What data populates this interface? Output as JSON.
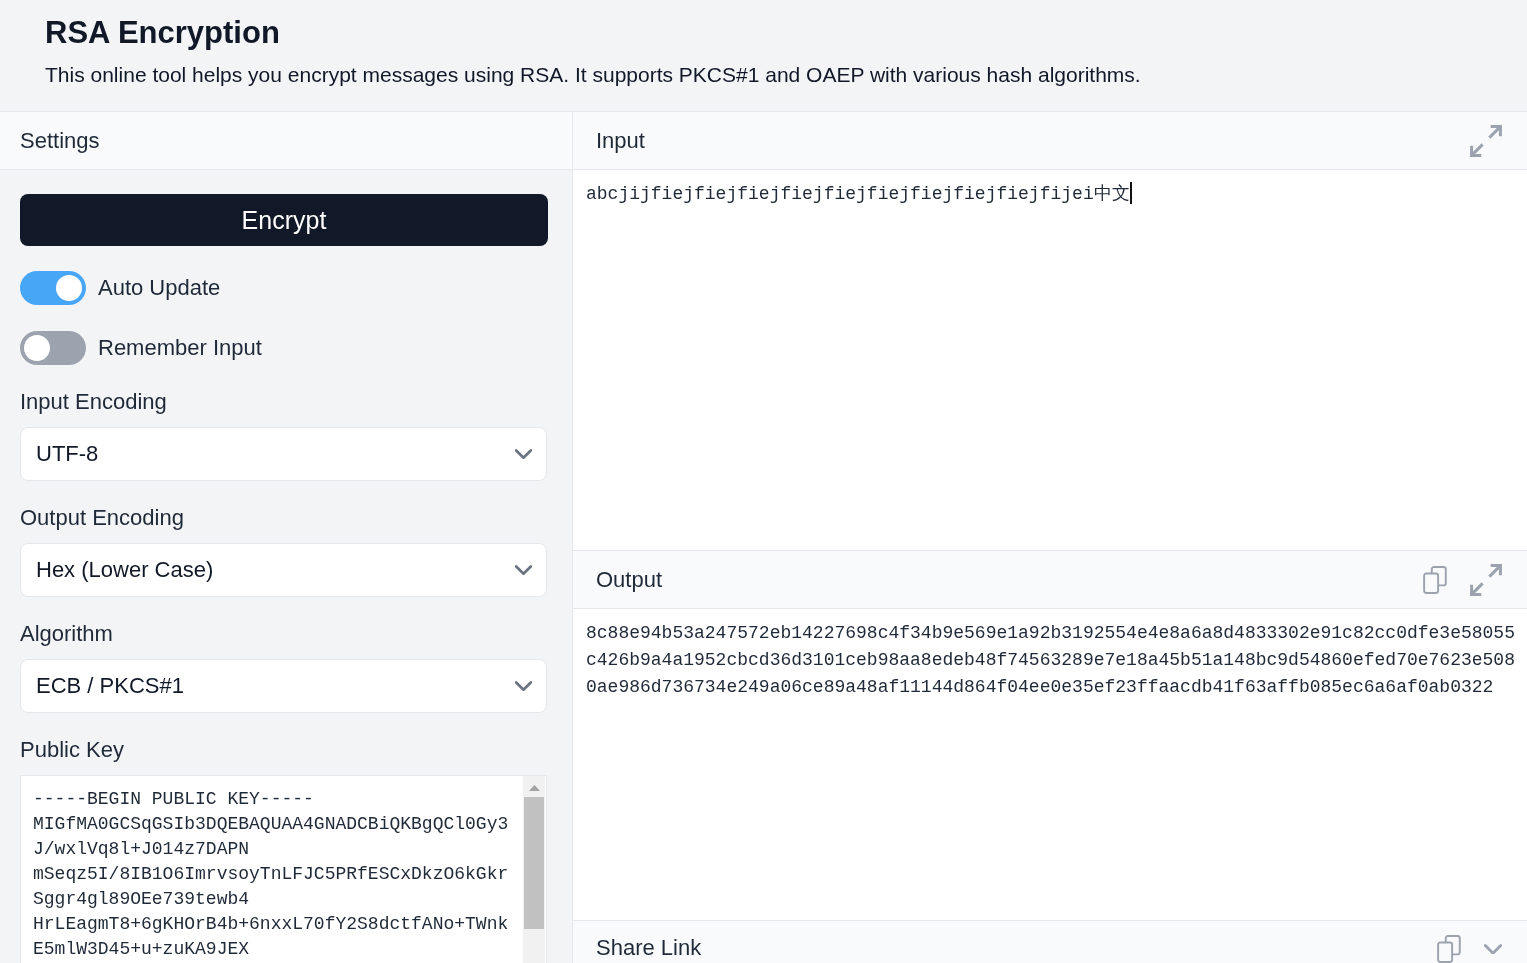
{
  "header": {
    "title": "RSA Encryption",
    "description": "This online tool helps you encrypt messages using RSA. It supports PKCS#1 and OAEP with various hash algorithms."
  },
  "settings": {
    "title": "Settings",
    "action": "Encrypt",
    "toggles": [
      {
        "label": "Auto Update",
        "on": true
      },
      {
        "label": "Remember Input",
        "on": false
      }
    ],
    "selects": [
      {
        "label": "Input Encoding",
        "value": "UTF-8"
      },
      {
        "label": "Output Encoding",
        "value": "Hex (Lower Case)"
      },
      {
        "label": "Algorithm",
        "value": "ECB / PKCS#1"
      }
    ],
    "public_key": {
      "label": "Public Key",
      "value": "-----BEGIN PUBLIC KEY-----\nMIGfMA0GCSqGSIb3DQEBAQUAA4GNADCBiQKBgQCl0Gy3J/wxlVq8l+J014z7DAPN\nmSeqz5I/8IB1O6ImrvsoyTnLFJC5PRfESCxDkzO6kGkrSggr4gl89OEe739tewb4\nHrLEagmT8+6gKHOrB4b+6nxxL70fY2S8dctfANo+TWnkE5mlW3D45+u+zuKA9JEX"
    }
  },
  "panels": [
    {
      "kind": "input",
      "title": "Input",
      "value": "abcjijfiejfiejfiejfiejfiejfiejfiejfiejfiejfijei中文",
      "focused": true
    },
    {
      "kind": "output",
      "title": "Output",
      "value": "8c88e94b53a247572eb14227698c4f34b9e569e1a92b3192554e4e8a6a8d4833302e91c82cc0dfe3e58055c426b9a4a1952cbcd36d3101ceb98aa8edeb48f74563289e7e18a45b51a148bc9d54860efed70e7623e5080ae986d736734e249a06ce89a48af11144d864f04ee0e35ef23ffaacdb41f63affb085ec6a6af0ab0322"
    },
    {
      "kind": "share",
      "title": "Share Link"
    }
  ]
}
